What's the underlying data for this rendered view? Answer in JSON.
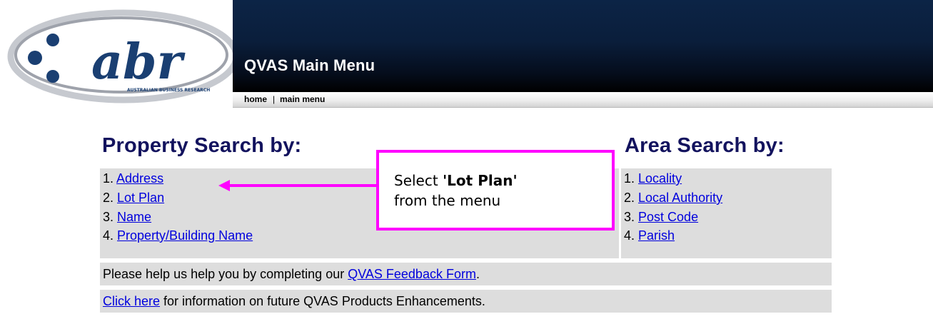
{
  "logo": {
    "text": "abr",
    "tagline": "AUSTRALIAN BUSINESS RESEARCH"
  },
  "header": {
    "title": "QVAS Main Menu"
  },
  "nav": {
    "home": "home",
    "separator": "|",
    "main_menu": "main menu"
  },
  "property_search": {
    "heading": "Property Search by:",
    "items": [
      {
        "num": "1.",
        "label": "Address"
      },
      {
        "num": "2.",
        "label": "Lot Plan"
      },
      {
        "num": "3.",
        "label": "Name"
      },
      {
        "num": "4.",
        "label": "Property/Building Name"
      }
    ]
  },
  "area_search": {
    "heading": "Area Search by:",
    "items": [
      {
        "num": "1.",
        "label": "Locality"
      },
      {
        "num": "2.",
        "label": "Local Authority"
      },
      {
        "num": "3.",
        "label": "Post Code"
      },
      {
        "num": "4.",
        "label": "Parish"
      }
    ]
  },
  "feedback": {
    "prefix": "Please help us help you by completing our ",
    "link": "QVAS Feedback Form",
    "suffix": "."
  },
  "enhancements": {
    "link": "Click here",
    "suffix": " for information on future QVAS Products Enhancements."
  },
  "callout": {
    "line1_prefix": "Select ",
    "line1_bold": "'Lot Plan'",
    "line2": "from the menu"
  },
  "colors": {
    "banner": "#0a1e3b",
    "heading": "#13135e",
    "link": "#0000dd",
    "panel": "#dddddd",
    "callout": "#ff00ff",
    "logo_blue": "#1a3f72",
    "logo_swoosh": "#b4b8c0"
  }
}
